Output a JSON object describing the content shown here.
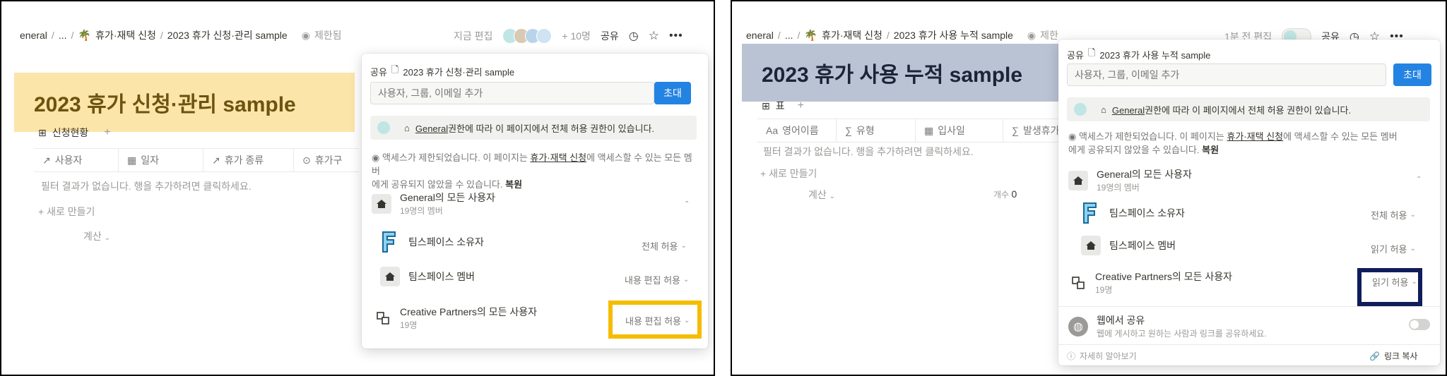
{
  "left": {
    "breadcrumb": [
      "eneral",
      "...",
      "휴가·재택 신청",
      "2023 휴가 신청·관리 sample"
    ],
    "restricted": "제한됨",
    "editing_now": "지금 편집",
    "plus_count": "+ 10명",
    "share": "공유",
    "page_title": "2023 휴가 신청·관리 sample",
    "view_tab": "신청현황",
    "columns": [
      "사용자",
      "일자",
      "휴가 종류",
      "휴가구"
    ],
    "empty_text": "필터 결과가 없습니다. 행을 추가하려면 클릭하세요.",
    "new_row": "+ 새로 만들기",
    "calc": "계산",
    "share_panel": {
      "header": "공유",
      "page": "2023 휴가 신청·관리 sample",
      "input_placeholder": "사용자, 그룹, 이메일 추가",
      "invite": "초대",
      "notice_link": "General",
      "notice_text": "권한에 따라 이 페이지에서 전체 허용 권한이 있습니다.",
      "restrict_text_1": "액세스가 제한되었습니다. 이 페이지는 ",
      "restrict_link": "휴가·재택 신청",
      "restrict_text_2": "에 액세스할 수 있는 모든 멤버",
      "restrict_text_3": "에게 공유되지 않았을 수 있습니다.",
      "restore": "복원",
      "group_name": "General의 모든 사용자",
      "group_sub": "19명의 멤버",
      "owner_label": "팀스페이스 소유자",
      "owner_perm": "전체 허용",
      "member_label": "팀스페이스 멤버",
      "member_perm": "내용 편집 허용",
      "cp_name": "Creative Partners의 모든 사용자",
      "cp_sub": "19명",
      "cp_perm": "내용 편집 허용"
    }
  },
  "right": {
    "breadcrumb": [
      "eneral",
      "...",
      "휴가·재택 신청",
      "2023 휴가 사용 누적 sample"
    ],
    "restricted": "제한",
    "edited": "1분 전 편집",
    "share": "공유",
    "page_title": "2023 휴가 사용 누적 sample",
    "view_tab": "표",
    "columns": [
      "영어이름",
      "유형",
      "입사일",
      "발생휴가"
    ],
    "empty_text": "필터 결과가 없습니다. 행을 추가하려면 클릭하세요.",
    "new_row": "+ 새로 만들기",
    "calc": "계산",
    "count_label": "개수",
    "count_value": "0",
    "share_panel": {
      "header": "공유",
      "page": "2023 휴가 사용 누적 sample",
      "input_placeholder": "사용자, 그룹, 이메일 추가",
      "invite": "초대",
      "notice_link": "General",
      "notice_text": "권한에 따라 이 페이지에서 전체 허용 권한이 있습니다.",
      "restrict_text_1": "액세스가 제한되었습니다. 이 페이지는 ",
      "restrict_link": "휴가·재택 신청",
      "restrict_text_2": "에 액세스할 수 있는 모든 멤버",
      "restrict_text_3": "에게 공유되지 않았을 수 있습니다.",
      "restore": "복원",
      "group_name": "General의 모든 사용자",
      "group_sub": "19명의 멤버",
      "owner_label": "팀스페이스 소유자",
      "owner_perm": "전체 허용",
      "member_label": "팀스페이스 멤버",
      "member_perm": "읽기 허용",
      "cp_name": "Creative Partners의 모든 사용자",
      "cp_sub": "19명",
      "cp_perm": "읽기 허용",
      "web_share_title": "웹에서 공유",
      "web_share_sub": "웹에 게시하고 원하는 사람과 링크를 공유하세요.",
      "learn_more": "자세히 알아보기",
      "copy_link": "링크 복사"
    }
  },
  "colors": {
    "highlight_yellow": "#f5bd00",
    "highlight_navy": "#101d5a",
    "title_bg_left": "#fbe5a8",
    "title_bg_right": "#b9c3d4",
    "invite_blue": "#2383e2"
  }
}
